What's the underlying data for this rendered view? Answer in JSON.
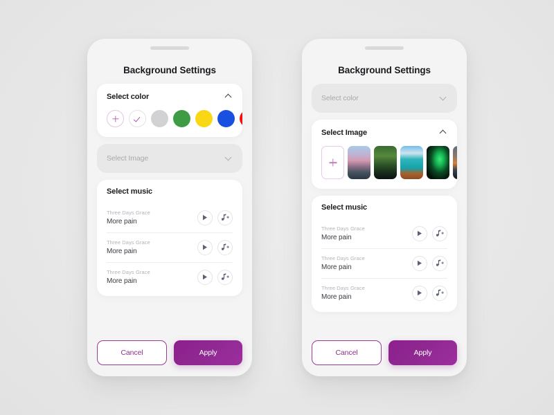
{
  "background_color": "#e9e9e9",
  "accent": {
    "purple": "#8e2f8e",
    "purple_light": "#b46bb4",
    "pink_border": "#e2c4e2"
  },
  "screens": [
    {
      "id": "left",
      "title": "Background Settings",
      "color_section": {
        "label": "Select color",
        "expanded": true,
        "chevron": "chevron-up-icon",
        "swatches": [
          {
            "name": "add-color",
            "type": "add",
            "color": "#ffffff"
          },
          {
            "name": "white-selected",
            "type": "check",
            "color": "#ffffff"
          },
          {
            "name": "gray",
            "type": "color",
            "color": "#d2d2d4"
          },
          {
            "name": "green",
            "type": "color",
            "color": "#3f9c45"
          },
          {
            "name": "yellow",
            "type": "color",
            "color": "#fad715"
          },
          {
            "name": "blue",
            "type": "color",
            "color": "#1a50e0"
          },
          {
            "name": "red",
            "type": "color",
            "color": "#f40d0d"
          },
          {
            "name": "amber",
            "type": "color",
            "color": "#c8921a"
          }
        ]
      },
      "image_section": {
        "label": "Select Image",
        "expanded": false,
        "chevron": "chevron-down-icon",
        "images": []
      },
      "music_section": {
        "label": "Select music",
        "tracks": [
          {
            "artist": "Three Days Grace",
            "song": "More pain",
            "play": "play-icon",
            "add": "add-music-icon"
          },
          {
            "artist": "Three Days Grace",
            "song": "More pain",
            "play": "play-icon",
            "add": "add-music-icon"
          },
          {
            "artist": "Three Days Grace",
            "song": "More pain",
            "play": "play-icon",
            "add": "add-music-icon"
          }
        ]
      },
      "footer": {
        "cancel_label": "Cancel",
        "apply_label": "Apply"
      }
    },
    {
      "id": "right",
      "title": "Background Settings",
      "color_section": {
        "label": "Select color",
        "expanded": false,
        "chevron": "chevron-down-icon",
        "swatches": []
      },
      "image_section": {
        "label": "Select Image",
        "expanded": true,
        "chevron": "chevron-up-icon",
        "images": [
          {
            "name": "add-image",
            "type": "add"
          },
          {
            "name": "sunset-beach",
            "type": "photo",
            "colors": [
              "#9fc3e2",
              "#c9a7c6",
              "#7d5f7a",
              "#3c4a58"
            ]
          },
          {
            "name": "forest-path",
            "type": "photo",
            "colors": [
              "#2f5a2c",
              "#4f7f3a",
              "#1d3520",
              "#0f1a12"
            ]
          },
          {
            "name": "turquoise-lagoon",
            "type": "photo",
            "colors": [
              "#68b4e4",
              "#2fb7b9",
              "#1aa0a6",
              "#a85f2a"
            ]
          },
          {
            "name": "aurora-borealis",
            "type": "photo",
            "colors": [
              "#05120a",
              "#18d05a",
              "#0a3a1c",
              "#030806"
            ]
          },
          {
            "name": "ocean-sunset",
            "type": "photo",
            "colors": [
              "#5b6b78",
              "#c4723a",
              "#2a3440",
              "#101820"
            ]
          }
        ]
      },
      "music_section": {
        "label": "Select music",
        "tracks": [
          {
            "artist": "Three Days Grace",
            "song": "More pain",
            "play": "play-icon",
            "add": "add-music-icon"
          },
          {
            "artist": "Three Days Grace",
            "song": "More pain",
            "play": "play-icon",
            "add": "add-music-icon"
          },
          {
            "artist": "Three Days Grace",
            "song": "More pain",
            "play": "play-icon",
            "add": "add-music-icon"
          }
        ]
      },
      "footer": {
        "cancel_label": "Cancel",
        "apply_label": "Apply"
      }
    }
  ]
}
